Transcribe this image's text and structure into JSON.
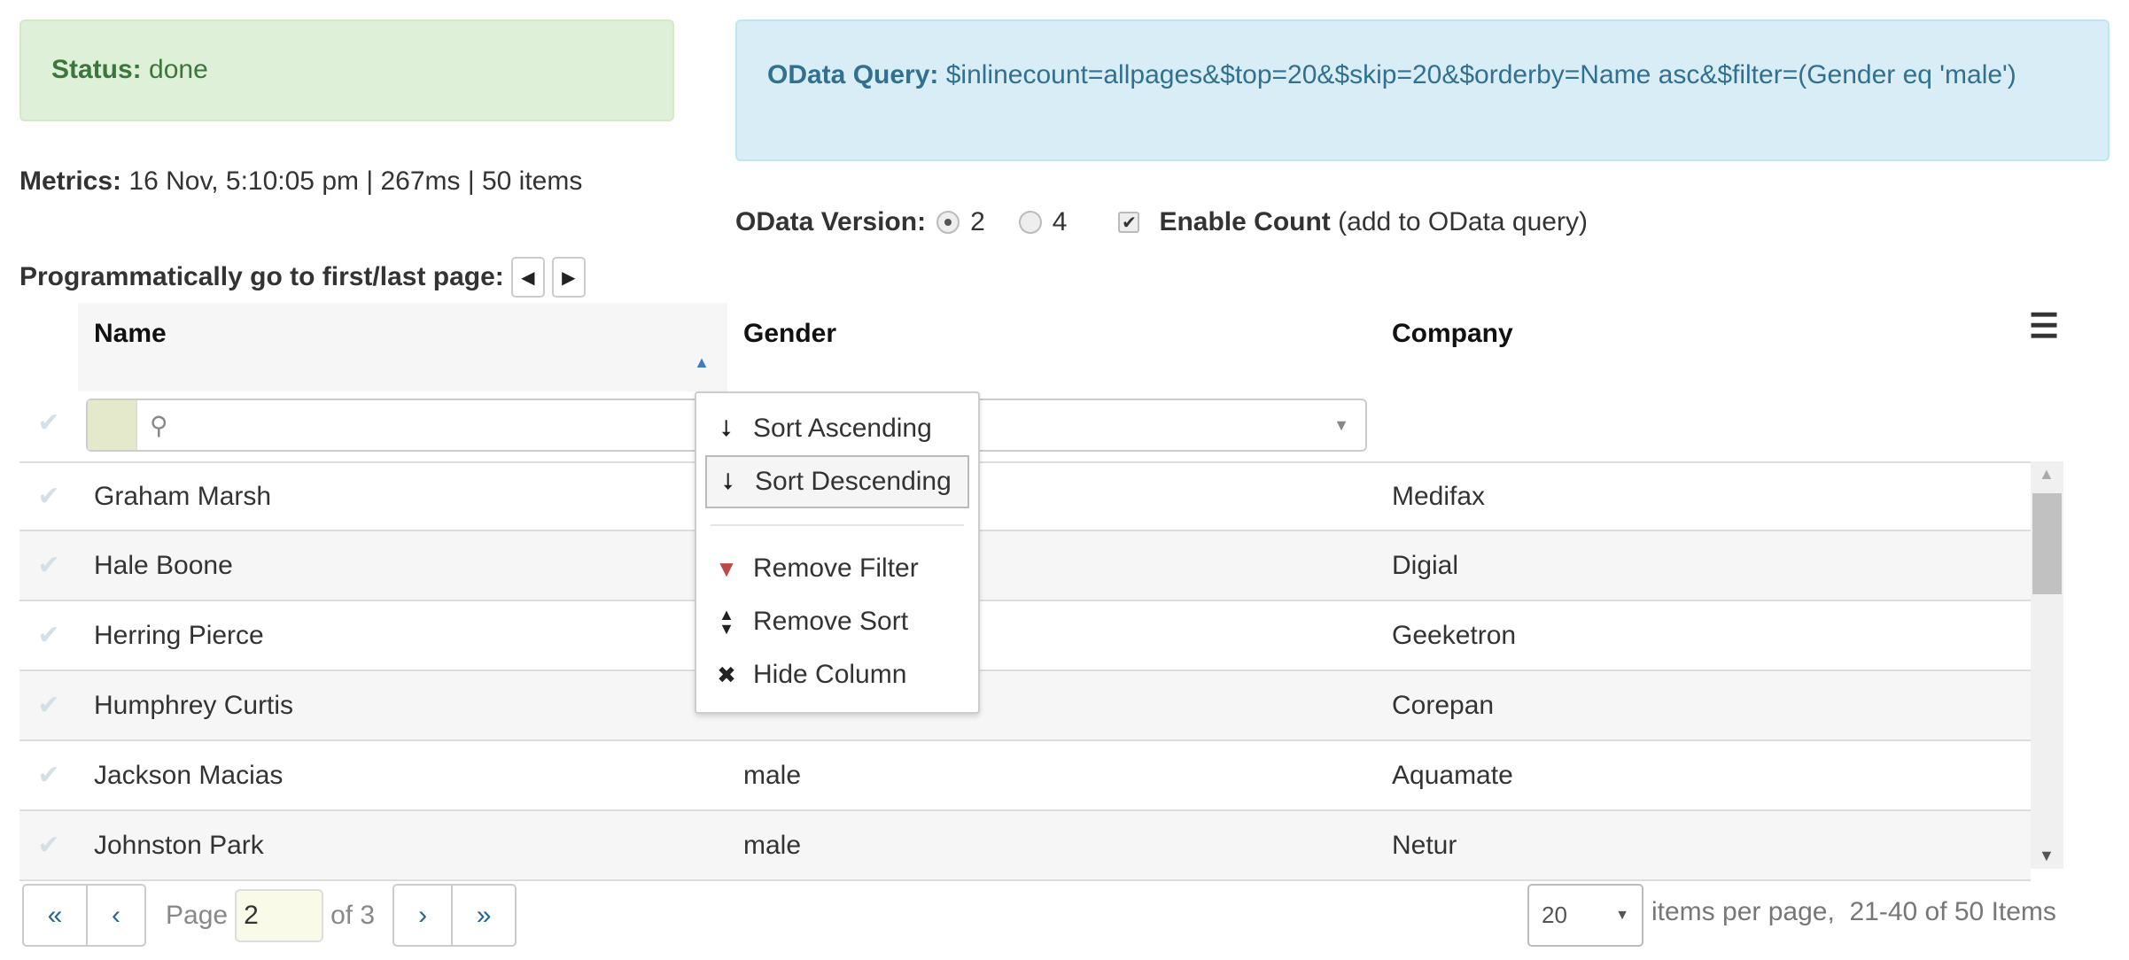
{
  "status": {
    "label": "Status:",
    "value": "done"
  },
  "query": {
    "label": "OData Query:",
    "value": "$inlinecount=allpages&$top=20&$skip=20&$orderby=Name asc&$filter=(Gender eq 'male')"
  },
  "metrics": {
    "label": "Metrics:",
    "value": "16 Nov, 5:10:05 pm | 267ms | 50 items"
  },
  "version": {
    "label": "OData Version:",
    "options": [
      "2",
      "4"
    ],
    "selected": "2",
    "count_label": "Enable Count",
    "count_note": "(add to OData query)",
    "count_checked": true
  },
  "programmatic": {
    "label": "Programmatically go to first/last page:"
  },
  "grid": {
    "columns": [
      "Name",
      "Gender",
      "Company"
    ],
    "sort": {
      "column": "Name",
      "direction": "asc"
    },
    "rows": [
      {
        "name": "Graham Marsh",
        "gender": "",
        "company": "Medifax"
      },
      {
        "name": "Hale Boone",
        "gender": "",
        "company": "Digial"
      },
      {
        "name": "Herring Pierce",
        "gender": "",
        "company": "Geeketron"
      },
      {
        "name": "Humphrey Curtis",
        "gender": "",
        "company": "Corepan"
      },
      {
        "name": "Jackson Macias",
        "gender": "male",
        "company": "Aquamate"
      },
      {
        "name": "Johnston Park",
        "gender": "male",
        "company": "Netur"
      }
    ]
  },
  "menu": {
    "items": [
      "Sort Ascending",
      "Sort Descending",
      "Remove Filter",
      "Remove Sort",
      "Hide Column"
    ],
    "filter_color": "#b94a48"
  },
  "pager": {
    "page_label": "Page",
    "page": "2",
    "of_label": "of 3",
    "page_size": "20",
    "per_page_label": "items per page,",
    "range": "21-40 of 50 Items"
  }
}
